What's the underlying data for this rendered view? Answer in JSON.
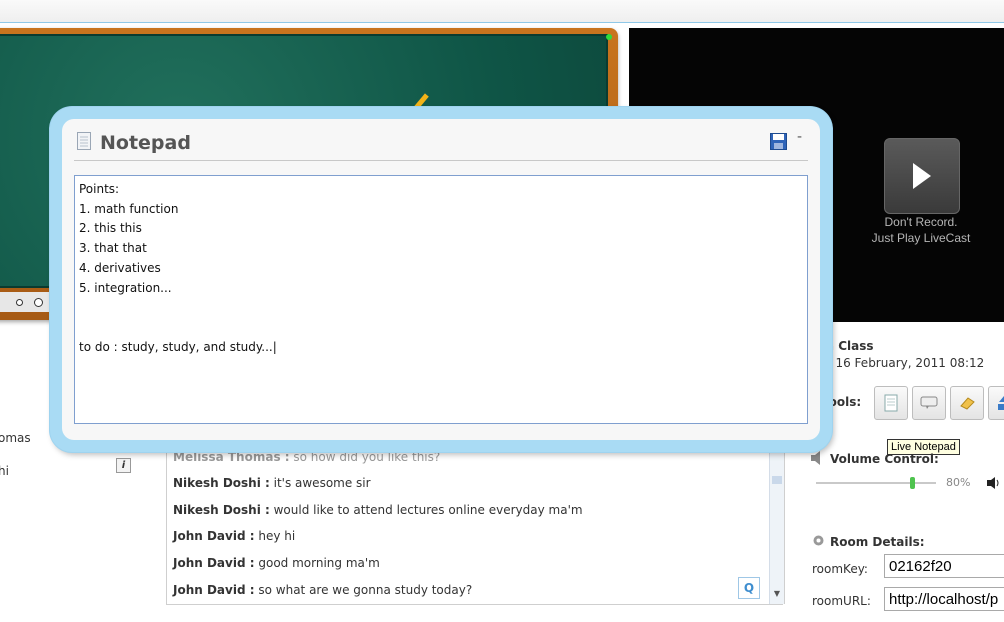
{
  "video": {
    "line1": "Don't Record.",
    "line2": "Just Play LiveCast"
  },
  "class_info": {
    "title_partial": "ra Class",
    "date_partial": "d: 16 February, 2011 08:12"
  },
  "tools": {
    "label_partial": "Tools:",
    "buttons": [
      "notepad-icon",
      "chat-bubble-icon",
      "eraser-icon",
      "upload-icon"
    ],
    "tooltip": "Live Notepad"
  },
  "volume": {
    "label": "Volume Control:",
    "percent_text": "80%",
    "level": 0.8
  },
  "room": {
    "title": "Room Details:",
    "key_label": "roomKey:",
    "key_value": "02162f20",
    "url_label": "roomURL:",
    "url_value": "http://localhost/p"
  },
  "participants_partial": [
    "omas",
    "hi"
  ],
  "chat": {
    "messages": [
      {
        "name": "Melissa Thomas :",
        "text": " so how did you like this?"
      },
      {
        "name": "Nikesh Doshi :",
        "text": " it's awesome sir"
      },
      {
        "name": "Nikesh Doshi :",
        "text": " would like to attend lectures online everyday ma'm"
      },
      {
        "name": "John David :",
        "text": " hey hi"
      },
      {
        "name": "John David :",
        "text": " good morning ma'm"
      },
      {
        "name": "John David :",
        "text": " so what are we gonna study today?"
      }
    ],
    "q_button": "Q"
  },
  "notepad": {
    "title": "Notepad",
    "minimize": "-",
    "content": "Points:\n1. math function\n2. this this\n3. that that\n4. derivatives\n5. integration...\n\n\nto do : study, study, and study...|"
  },
  "colors": {
    "modal_border": "#a9dbf4",
    "chalkboard": "#0f5546",
    "board_frame": "#b8651a",
    "volume_thumb": "#4ec34e"
  }
}
